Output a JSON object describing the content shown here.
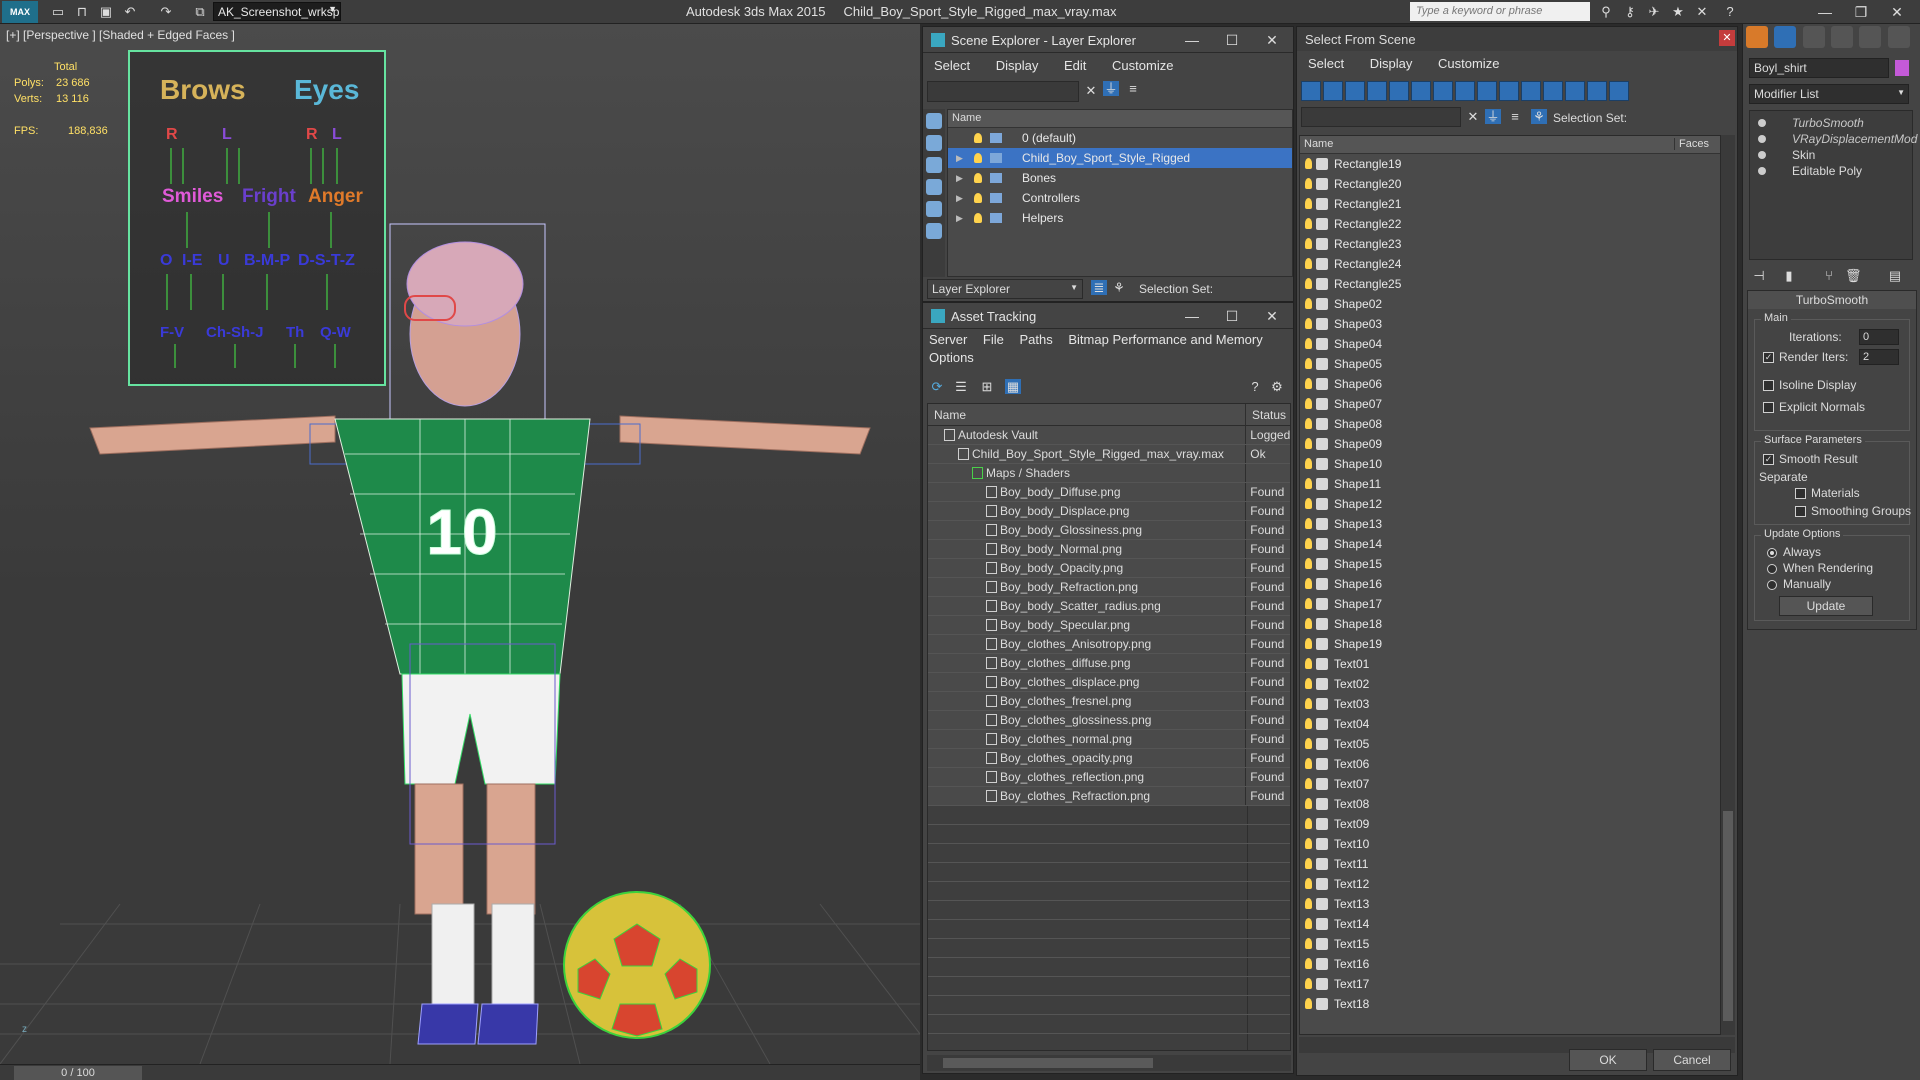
{
  "titlebar": {
    "logo_text": "MAX",
    "workspace": "AK_Screenshot_wrksp",
    "app_name": "Autodesk 3ds Max  2015",
    "file_name": "Child_Boy_Sport_Style_Rigged_max_vray.max",
    "search_placeholder": "Type a keyword or phrase"
  },
  "viewport": {
    "label": "[+] [Perspective ] [Shaded + Edged Faces ]",
    "stats": {
      "total_label": "Total",
      "polys_label": "Polys:",
      "polys": "23 686",
      "verts_label": "Verts:",
      "verts": "13 116",
      "fps_label": "FPS:",
      "fps": "188,836"
    },
    "board": {
      "brows": "Brows",
      "eyes": "Eyes",
      "r1": "R",
      "l1": "L",
      "r2": "R",
      "l2": "L",
      "smiles": "Smiles",
      "fright": "Fright",
      "anger": "Anger",
      "o": "O",
      "ie": "I-E",
      "u": "U",
      "bmp": "B-M-P",
      "dstz": "D-S-T-Z",
      "fv": "F-V",
      "chshj": "Ch-Sh-J",
      "th": "Th",
      "qw": "Q-W"
    },
    "jersey_number": "10",
    "axis_label": "z"
  },
  "time_slider": "0 / 100",
  "scene_explorer": {
    "title": "Scene Explorer - Layer Explorer",
    "menus": [
      "Select",
      "Display",
      "Edit",
      "Customize"
    ],
    "column_name": "Name",
    "layers": [
      {
        "label": "0 (default)",
        "selected": false,
        "expandable": false
      },
      {
        "label": "Child_Boy_Sport_Style_Rigged",
        "selected": true,
        "expandable": true
      },
      {
        "label": "Bones",
        "selected": false,
        "expandable": true
      },
      {
        "label": "Controllers",
        "selected": false,
        "expandable": true
      },
      {
        "label": "Helpers",
        "selected": false,
        "expandable": true
      }
    ],
    "explorer_dropdown": "Layer Explorer",
    "selection_set_label": "Selection Set:"
  },
  "asset_tracking": {
    "title": "Asset Tracking",
    "menus": [
      "Server",
      "File",
      "Paths",
      "Bitmap Performance and Memory"
    ],
    "menu_options": "Options",
    "col_name": "Name",
    "col_status": "Status",
    "rows": [
      {
        "name": "Autodesk Vault",
        "status": "Logged",
        "indent": 0
      },
      {
        "name": "Child_Boy_Sport_Style_Rigged_max_vray.max",
        "status": "Ok",
        "indent": 1
      },
      {
        "name": "Maps / Shaders",
        "status": "",
        "indent": 2
      },
      {
        "name": "Boy_body_Diffuse.png",
        "status": "Found",
        "indent": 3
      },
      {
        "name": "Boy_body_Displace.png",
        "status": "Found",
        "indent": 3
      },
      {
        "name": "Boy_body_Glossiness.png",
        "status": "Found",
        "indent": 3
      },
      {
        "name": "Boy_body_Normal.png",
        "status": "Found",
        "indent": 3
      },
      {
        "name": "Boy_body_Opacity.png",
        "status": "Found",
        "indent": 3
      },
      {
        "name": "Boy_body_Refraction.png",
        "status": "Found",
        "indent": 3
      },
      {
        "name": "Boy_body_Scatter_radius.png",
        "status": "Found",
        "indent": 3
      },
      {
        "name": "Boy_body_Specular.png",
        "status": "Found",
        "indent": 3
      },
      {
        "name": "Boy_clothes_Anisotropy.png",
        "status": "Found",
        "indent": 3
      },
      {
        "name": "Boy_clothes_diffuse.png",
        "status": "Found",
        "indent": 3
      },
      {
        "name": "Boy_clothes_displace.png",
        "status": "Found",
        "indent": 3
      },
      {
        "name": "Boy_clothes_fresnel.png",
        "status": "Found",
        "indent": 3
      },
      {
        "name": "Boy_clothes_glossiness.png",
        "status": "Found",
        "indent": 3
      },
      {
        "name": "Boy_clothes_normal.png",
        "status": "Found",
        "indent": 3
      },
      {
        "name": "Boy_clothes_opacity.png",
        "status": "Found",
        "indent": 3
      },
      {
        "name": "Boy_clothes_reflection.png",
        "status": "Found",
        "indent": 3
      },
      {
        "name": "Boy_clothes_Refraction.png",
        "status": "Found",
        "indent": 3
      }
    ]
  },
  "select_from_scene": {
    "title": "Select From Scene",
    "menus": [
      "Select",
      "Display",
      "Customize"
    ],
    "selection_set_label": "Selection Set:",
    "col_name": "Name",
    "col_faces": "Faces",
    "objects": [
      "Rectangle19",
      "Rectangle20",
      "Rectangle21",
      "Rectangle22",
      "Rectangle23",
      "Rectangle24",
      "Rectangle25",
      "Shape02",
      "Shape03",
      "Shape04",
      "Shape05",
      "Shape06",
      "Shape07",
      "Shape08",
      "Shape09",
      "Shape10",
      "Shape11",
      "Shape12",
      "Shape13",
      "Shape14",
      "Shape15",
      "Shape16",
      "Shape17",
      "Shape18",
      "Shape19",
      "Text01",
      "Text02",
      "Text03",
      "Text04",
      "Text05",
      "Text06",
      "Text07",
      "Text08",
      "Text09",
      "Text10",
      "Text11",
      "Text12",
      "Text13",
      "Text14",
      "Text15",
      "Text16",
      "Text17",
      "Text18"
    ],
    "ok": "OK",
    "cancel": "Cancel"
  },
  "command_panel": {
    "object_name": "Boyl_shirt",
    "modifier_list": "Modifier List",
    "stack": [
      {
        "label": "TurboSmooth",
        "italic": true
      },
      {
        "label": "VRayDisplacementMod",
        "italic": true
      },
      {
        "label": "Skin",
        "italic": false
      },
      {
        "label": "Editable Poly",
        "italic": false
      }
    ],
    "rollout_title": "TurboSmooth",
    "main_group": "Main",
    "iterations_label": "Iterations:",
    "iterations": "0",
    "render_iters_label": "Render Iters:",
    "render_iters": "2",
    "isoline": "Isoline Display",
    "explicit_normals": "Explicit Normals",
    "surface_group": "Surface Parameters",
    "smooth_result": "Smooth Result",
    "separate": "Separate",
    "materials": "Materials",
    "smoothing_groups": "Smoothing Groups",
    "update_group": "Update Options",
    "always": "Always",
    "when_rendering": "When Rendering",
    "manually": "Manually",
    "update_button": "Update"
  }
}
